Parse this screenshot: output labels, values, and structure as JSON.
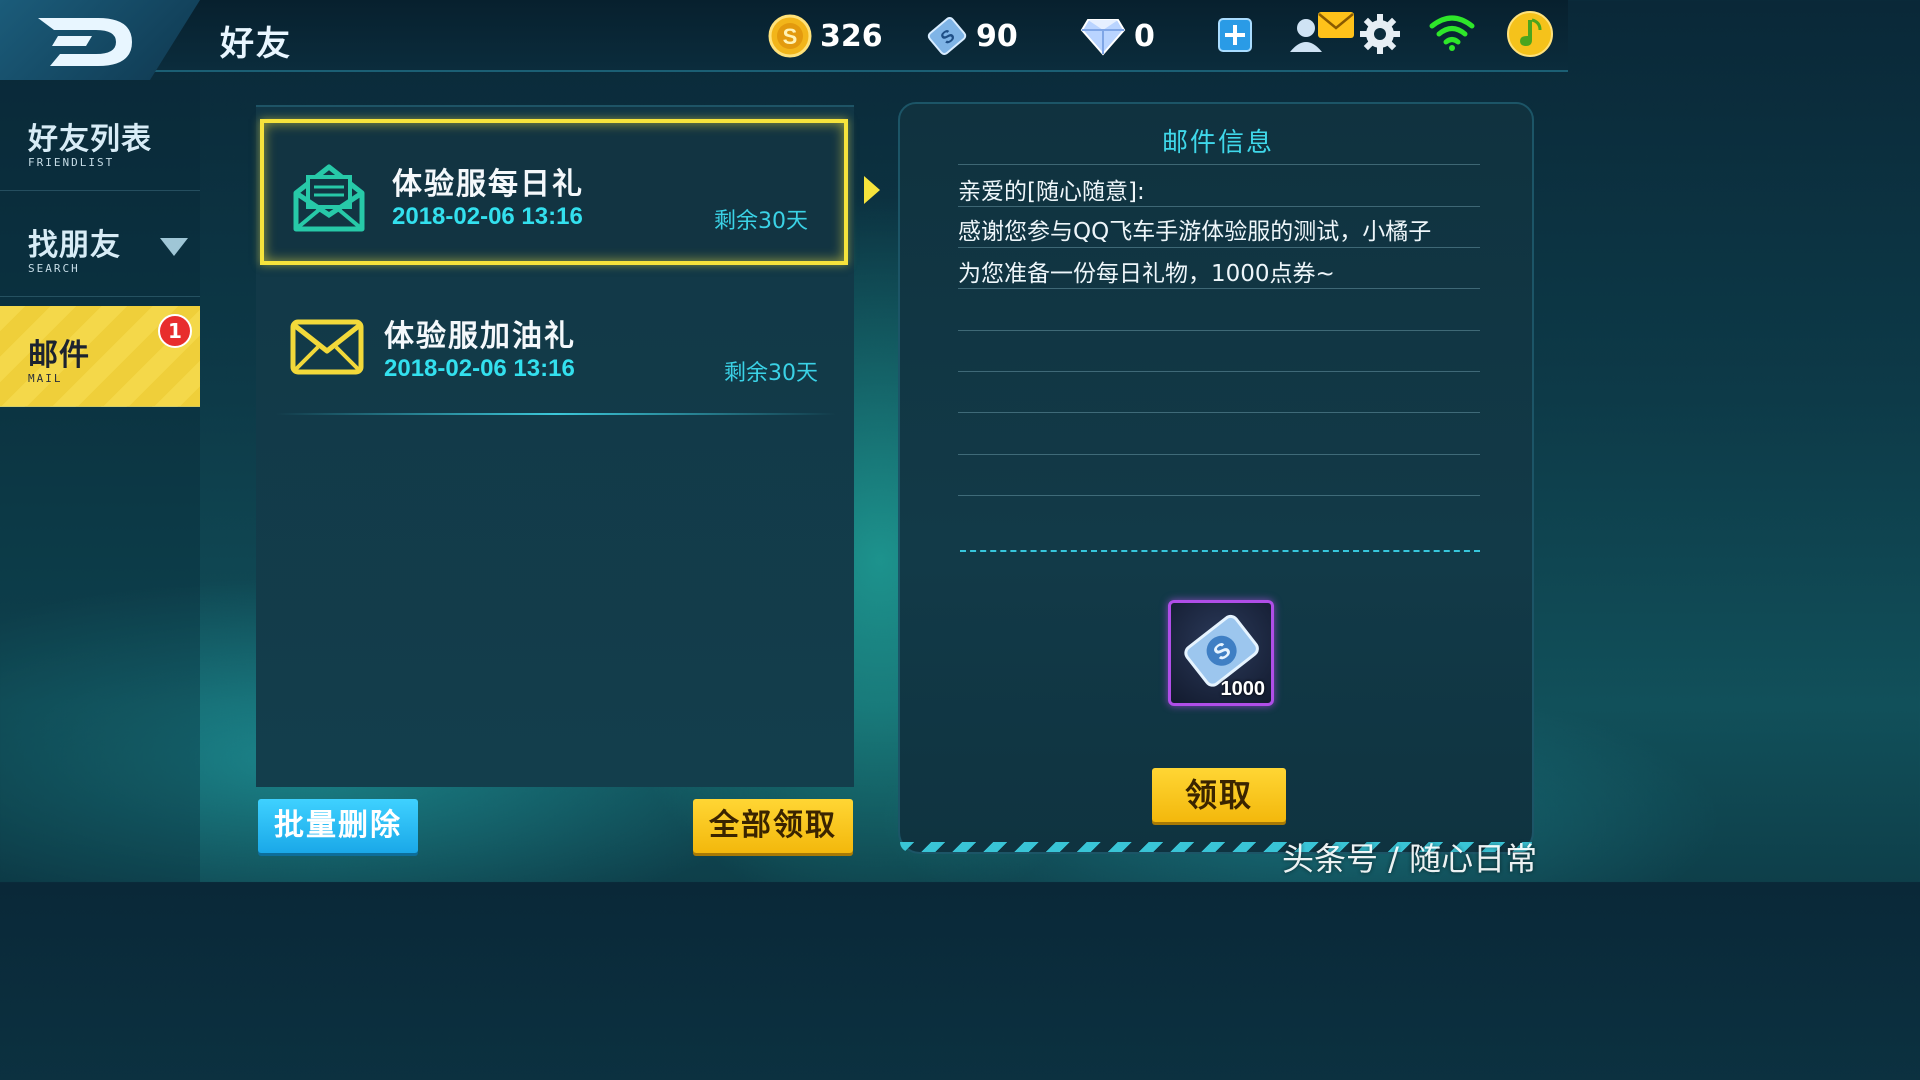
{
  "header": {
    "title": "好友",
    "gold_coins": "326",
    "coupons": "90",
    "diamonds": "0"
  },
  "sidebar": {
    "items": [
      {
        "label": "好友列表",
        "sublabel": "FRIENDLIST"
      },
      {
        "label": "找朋友",
        "sublabel": "SEARCH"
      },
      {
        "label": "邮件",
        "sublabel": "MAIL",
        "badge": "1"
      }
    ]
  },
  "mail_list": {
    "items": [
      {
        "title": "体验服每日礼",
        "date": "2018-02-06 13:16",
        "remaining": "剩余30天",
        "icon": "open-envelope-icon",
        "selected": true
      },
      {
        "title": "体验服加油礼",
        "date": "2018-02-06 13:16",
        "remaining": "剩余30天",
        "icon": "envelope-icon",
        "selected": false
      }
    ],
    "batch_delete_label": "批量删除",
    "claim_all_label": "全部领取"
  },
  "mail_info": {
    "title": "邮件信息",
    "lines": [
      "亲爱的[随心随意]:",
      "感谢您参与QQ飞车手游体验服的测试，小橘子",
      "为您准备一份每日礼物，1000点券~"
    ],
    "reward_qty": "1000",
    "claim_label": "领取"
  },
  "watermark": "头条号 / 随心日常",
  "colors": {
    "accent_yellow": "#f6e33c",
    "accent_cyan": "#33e0ee",
    "button_blue": "#1aa8e8",
    "reward_border": "#b04ee8"
  }
}
